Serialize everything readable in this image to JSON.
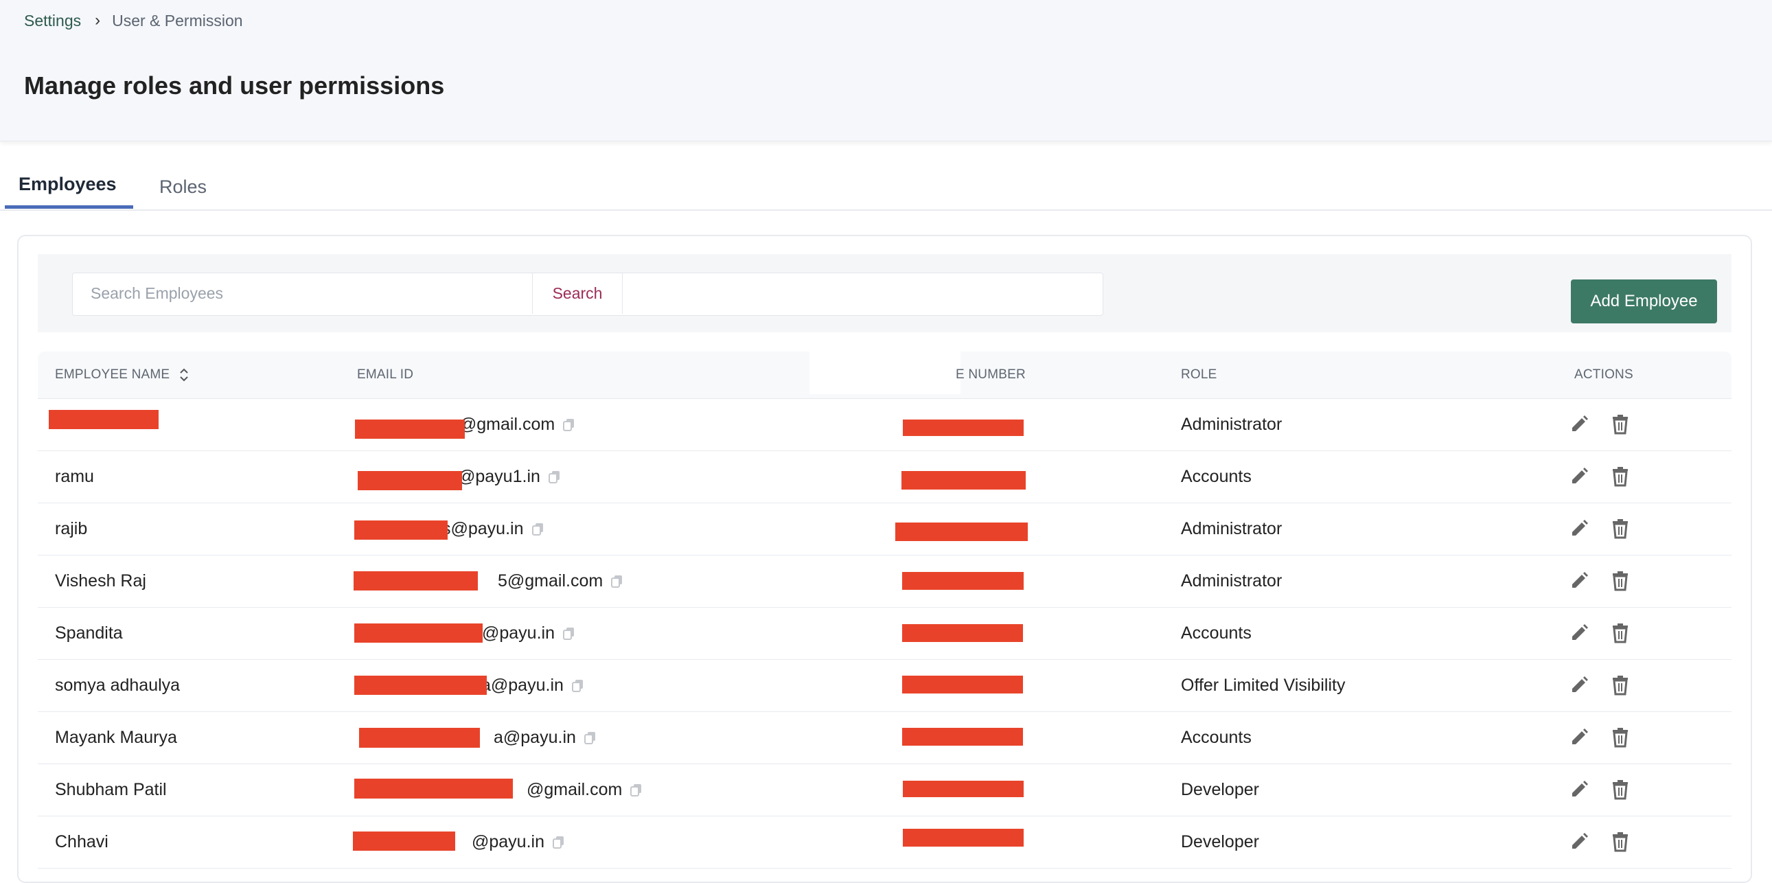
{
  "breadcrumb": {
    "root": "Settings",
    "current": "User & Permission"
  },
  "page": {
    "title": "Manage roles and user permissions"
  },
  "tabs": {
    "employees": "Employees",
    "roles": "Roles"
  },
  "toolbar": {
    "search_placeholder": "Search Employees",
    "search_label": "Search",
    "add_label": "Add Employee"
  },
  "table": {
    "headers": {
      "name": "EMPLOYEE NAME",
      "email": "EMAIL ID",
      "phone": "E NUMBER",
      "role": "ROLE",
      "actions": "ACTIONS"
    },
    "rows": [
      {
        "name": "",
        "email": "n@gmail.com",
        "role": "Administrator"
      },
      {
        "name": "ramu",
        "email": "@payu1.in",
        "role": "Accounts"
      },
      {
        "name": "rajib",
        "email": "s@payu.in",
        "role": "Administrator"
      },
      {
        "name": "Vishesh Raj",
        "email": "5@gmail.com",
        "role": "Administrator"
      },
      {
        "name": "Spandita",
        "email": "@payu.in",
        "role": "Accounts"
      },
      {
        "name": "somya adhaulya",
        "email": "a@payu.in",
        "role": "Offer Limited Visibility"
      },
      {
        "name": "Mayank Maurya",
        "email": "a@payu.in",
        "role": "Accounts"
      },
      {
        "name": "Shubham Patil",
        "email": "@gmail.com",
        "role": "Developer"
      },
      {
        "name": "Chhavi",
        "email": "@payu.in",
        "role": "Developer"
      }
    ]
  },
  "colors": {
    "accent": "#4a6cb8",
    "primary_button": "#3d7a66",
    "search_text": "#9b2c55",
    "redaction": "#e8432a"
  },
  "icons": {
    "breadcrumb_separator": "chevron-right-icon",
    "sort": "sort-icon",
    "copy": "copy-icon",
    "edit": "pencil-icon",
    "delete": "trash-icon"
  }
}
